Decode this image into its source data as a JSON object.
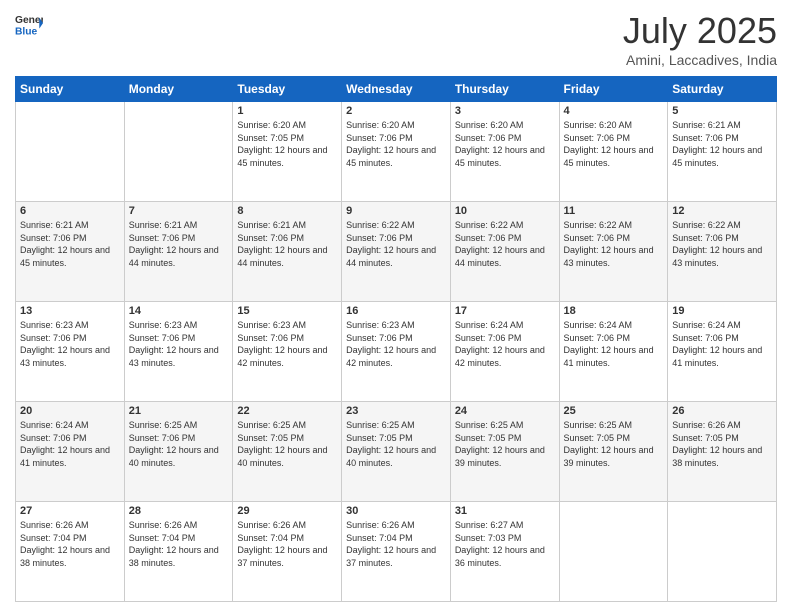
{
  "header": {
    "logo_general": "General",
    "logo_blue": "Blue",
    "month_year": "July 2025",
    "location": "Amini, Laccadives, India"
  },
  "calendar": {
    "days_of_week": [
      "Sunday",
      "Monday",
      "Tuesday",
      "Wednesday",
      "Thursday",
      "Friday",
      "Saturday"
    ],
    "weeks": [
      {
        "cells": [
          {
            "day": "",
            "info": ""
          },
          {
            "day": "",
            "info": ""
          },
          {
            "day": "1",
            "info": "Sunrise: 6:20 AM\nSunset: 7:05 PM\nDaylight: 12 hours and 45 minutes."
          },
          {
            "day": "2",
            "info": "Sunrise: 6:20 AM\nSunset: 7:06 PM\nDaylight: 12 hours and 45 minutes."
          },
          {
            "day": "3",
            "info": "Sunrise: 6:20 AM\nSunset: 7:06 PM\nDaylight: 12 hours and 45 minutes."
          },
          {
            "day": "4",
            "info": "Sunrise: 6:20 AM\nSunset: 7:06 PM\nDaylight: 12 hours and 45 minutes."
          },
          {
            "day": "5",
            "info": "Sunrise: 6:21 AM\nSunset: 7:06 PM\nDaylight: 12 hours and 45 minutes."
          }
        ]
      },
      {
        "cells": [
          {
            "day": "6",
            "info": "Sunrise: 6:21 AM\nSunset: 7:06 PM\nDaylight: 12 hours and 45 minutes."
          },
          {
            "day": "7",
            "info": "Sunrise: 6:21 AM\nSunset: 7:06 PM\nDaylight: 12 hours and 44 minutes."
          },
          {
            "day": "8",
            "info": "Sunrise: 6:21 AM\nSunset: 7:06 PM\nDaylight: 12 hours and 44 minutes."
          },
          {
            "day": "9",
            "info": "Sunrise: 6:22 AM\nSunset: 7:06 PM\nDaylight: 12 hours and 44 minutes."
          },
          {
            "day": "10",
            "info": "Sunrise: 6:22 AM\nSunset: 7:06 PM\nDaylight: 12 hours and 44 minutes."
          },
          {
            "day": "11",
            "info": "Sunrise: 6:22 AM\nSunset: 7:06 PM\nDaylight: 12 hours and 43 minutes."
          },
          {
            "day": "12",
            "info": "Sunrise: 6:22 AM\nSunset: 7:06 PM\nDaylight: 12 hours and 43 minutes."
          }
        ]
      },
      {
        "cells": [
          {
            "day": "13",
            "info": "Sunrise: 6:23 AM\nSunset: 7:06 PM\nDaylight: 12 hours and 43 minutes."
          },
          {
            "day": "14",
            "info": "Sunrise: 6:23 AM\nSunset: 7:06 PM\nDaylight: 12 hours and 43 minutes."
          },
          {
            "day": "15",
            "info": "Sunrise: 6:23 AM\nSunset: 7:06 PM\nDaylight: 12 hours and 42 minutes."
          },
          {
            "day": "16",
            "info": "Sunrise: 6:23 AM\nSunset: 7:06 PM\nDaylight: 12 hours and 42 minutes."
          },
          {
            "day": "17",
            "info": "Sunrise: 6:24 AM\nSunset: 7:06 PM\nDaylight: 12 hours and 42 minutes."
          },
          {
            "day": "18",
            "info": "Sunrise: 6:24 AM\nSunset: 7:06 PM\nDaylight: 12 hours and 41 minutes."
          },
          {
            "day": "19",
            "info": "Sunrise: 6:24 AM\nSunset: 7:06 PM\nDaylight: 12 hours and 41 minutes."
          }
        ]
      },
      {
        "cells": [
          {
            "day": "20",
            "info": "Sunrise: 6:24 AM\nSunset: 7:06 PM\nDaylight: 12 hours and 41 minutes."
          },
          {
            "day": "21",
            "info": "Sunrise: 6:25 AM\nSunset: 7:06 PM\nDaylight: 12 hours and 40 minutes."
          },
          {
            "day": "22",
            "info": "Sunrise: 6:25 AM\nSunset: 7:05 PM\nDaylight: 12 hours and 40 minutes."
          },
          {
            "day": "23",
            "info": "Sunrise: 6:25 AM\nSunset: 7:05 PM\nDaylight: 12 hours and 40 minutes."
          },
          {
            "day": "24",
            "info": "Sunrise: 6:25 AM\nSunset: 7:05 PM\nDaylight: 12 hours and 39 minutes."
          },
          {
            "day": "25",
            "info": "Sunrise: 6:25 AM\nSunset: 7:05 PM\nDaylight: 12 hours and 39 minutes."
          },
          {
            "day": "26",
            "info": "Sunrise: 6:26 AM\nSunset: 7:05 PM\nDaylight: 12 hours and 38 minutes."
          }
        ]
      },
      {
        "cells": [
          {
            "day": "27",
            "info": "Sunrise: 6:26 AM\nSunset: 7:04 PM\nDaylight: 12 hours and 38 minutes."
          },
          {
            "day": "28",
            "info": "Sunrise: 6:26 AM\nSunset: 7:04 PM\nDaylight: 12 hours and 38 minutes."
          },
          {
            "day": "29",
            "info": "Sunrise: 6:26 AM\nSunset: 7:04 PM\nDaylight: 12 hours and 37 minutes."
          },
          {
            "day": "30",
            "info": "Sunrise: 6:26 AM\nSunset: 7:04 PM\nDaylight: 12 hours and 37 minutes."
          },
          {
            "day": "31",
            "info": "Sunrise: 6:27 AM\nSunset: 7:03 PM\nDaylight: 12 hours and 36 minutes."
          },
          {
            "day": "",
            "info": ""
          },
          {
            "day": "",
            "info": ""
          }
        ]
      }
    ]
  }
}
